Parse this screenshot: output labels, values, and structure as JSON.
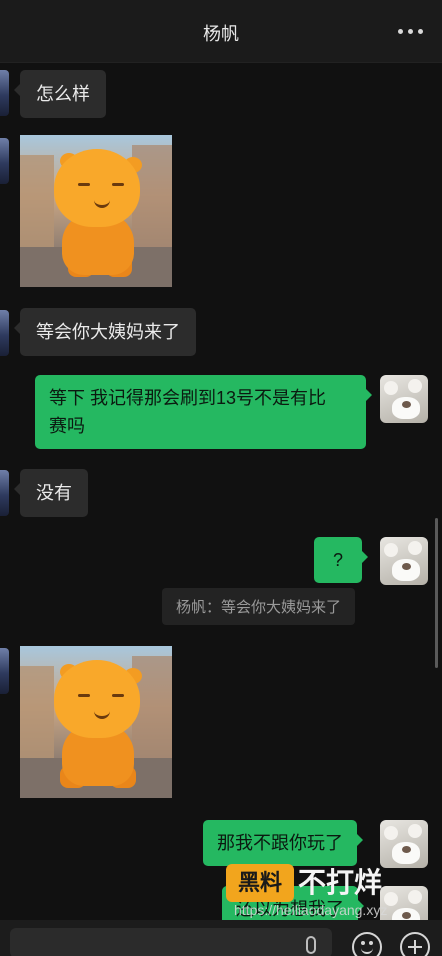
{
  "header": {
    "title": "杨帆",
    "more_icon": "more-dots-icon"
  },
  "messages": [
    {
      "side": "left",
      "type": "text",
      "text": "怎么样"
    },
    {
      "side": "left",
      "type": "sticker",
      "icon": "orange-cartoon-sticker"
    },
    {
      "side": "left",
      "type": "text",
      "text": "等会你大姨妈来了"
    },
    {
      "side": "right",
      "type": "text",
      "lines": [
        "等下 我记得那会刷到13号不是有比",
        "赛吗"
      ]
    },
    {
      "side": "left",
      "type": "text",
      "text": "没有"
    },
    {
      "side": "right",
      "type": "text",
      "text": "?"
    },
    {
      "side": "right",
      "type": "quote",
      "text": "杨帆：等会你大姨妈来了"
    },
    {
      "side": "left",
      "type": "sticker",
      "icon": "orange-cartoon-sticker"
    },
    {
      "side": "right",
      "type": "text",
      "text": "那我不跟你玩了"
    },
    {
      "side": "right",
      "type": "text",
      "text": "还以为想我了"
    }
  ],
  "watermark": {
    "logo": "黑料",
    "title": "不打烊",
    "url": "https://heiliaodayang.xyz"
  },
  "input_bar": {
    "voice_icon": "microphone-icon",
    "emoji_icon": "emoji-icon",
    "plus_icon": "plus-icon"
  },
  "colors": {
    "background": "#111111",
    "bubble_left": "#2c2c2c",
    "bubble_right": "#25b861",
    "watermark_logo": "#f2a51d"
  }
}
